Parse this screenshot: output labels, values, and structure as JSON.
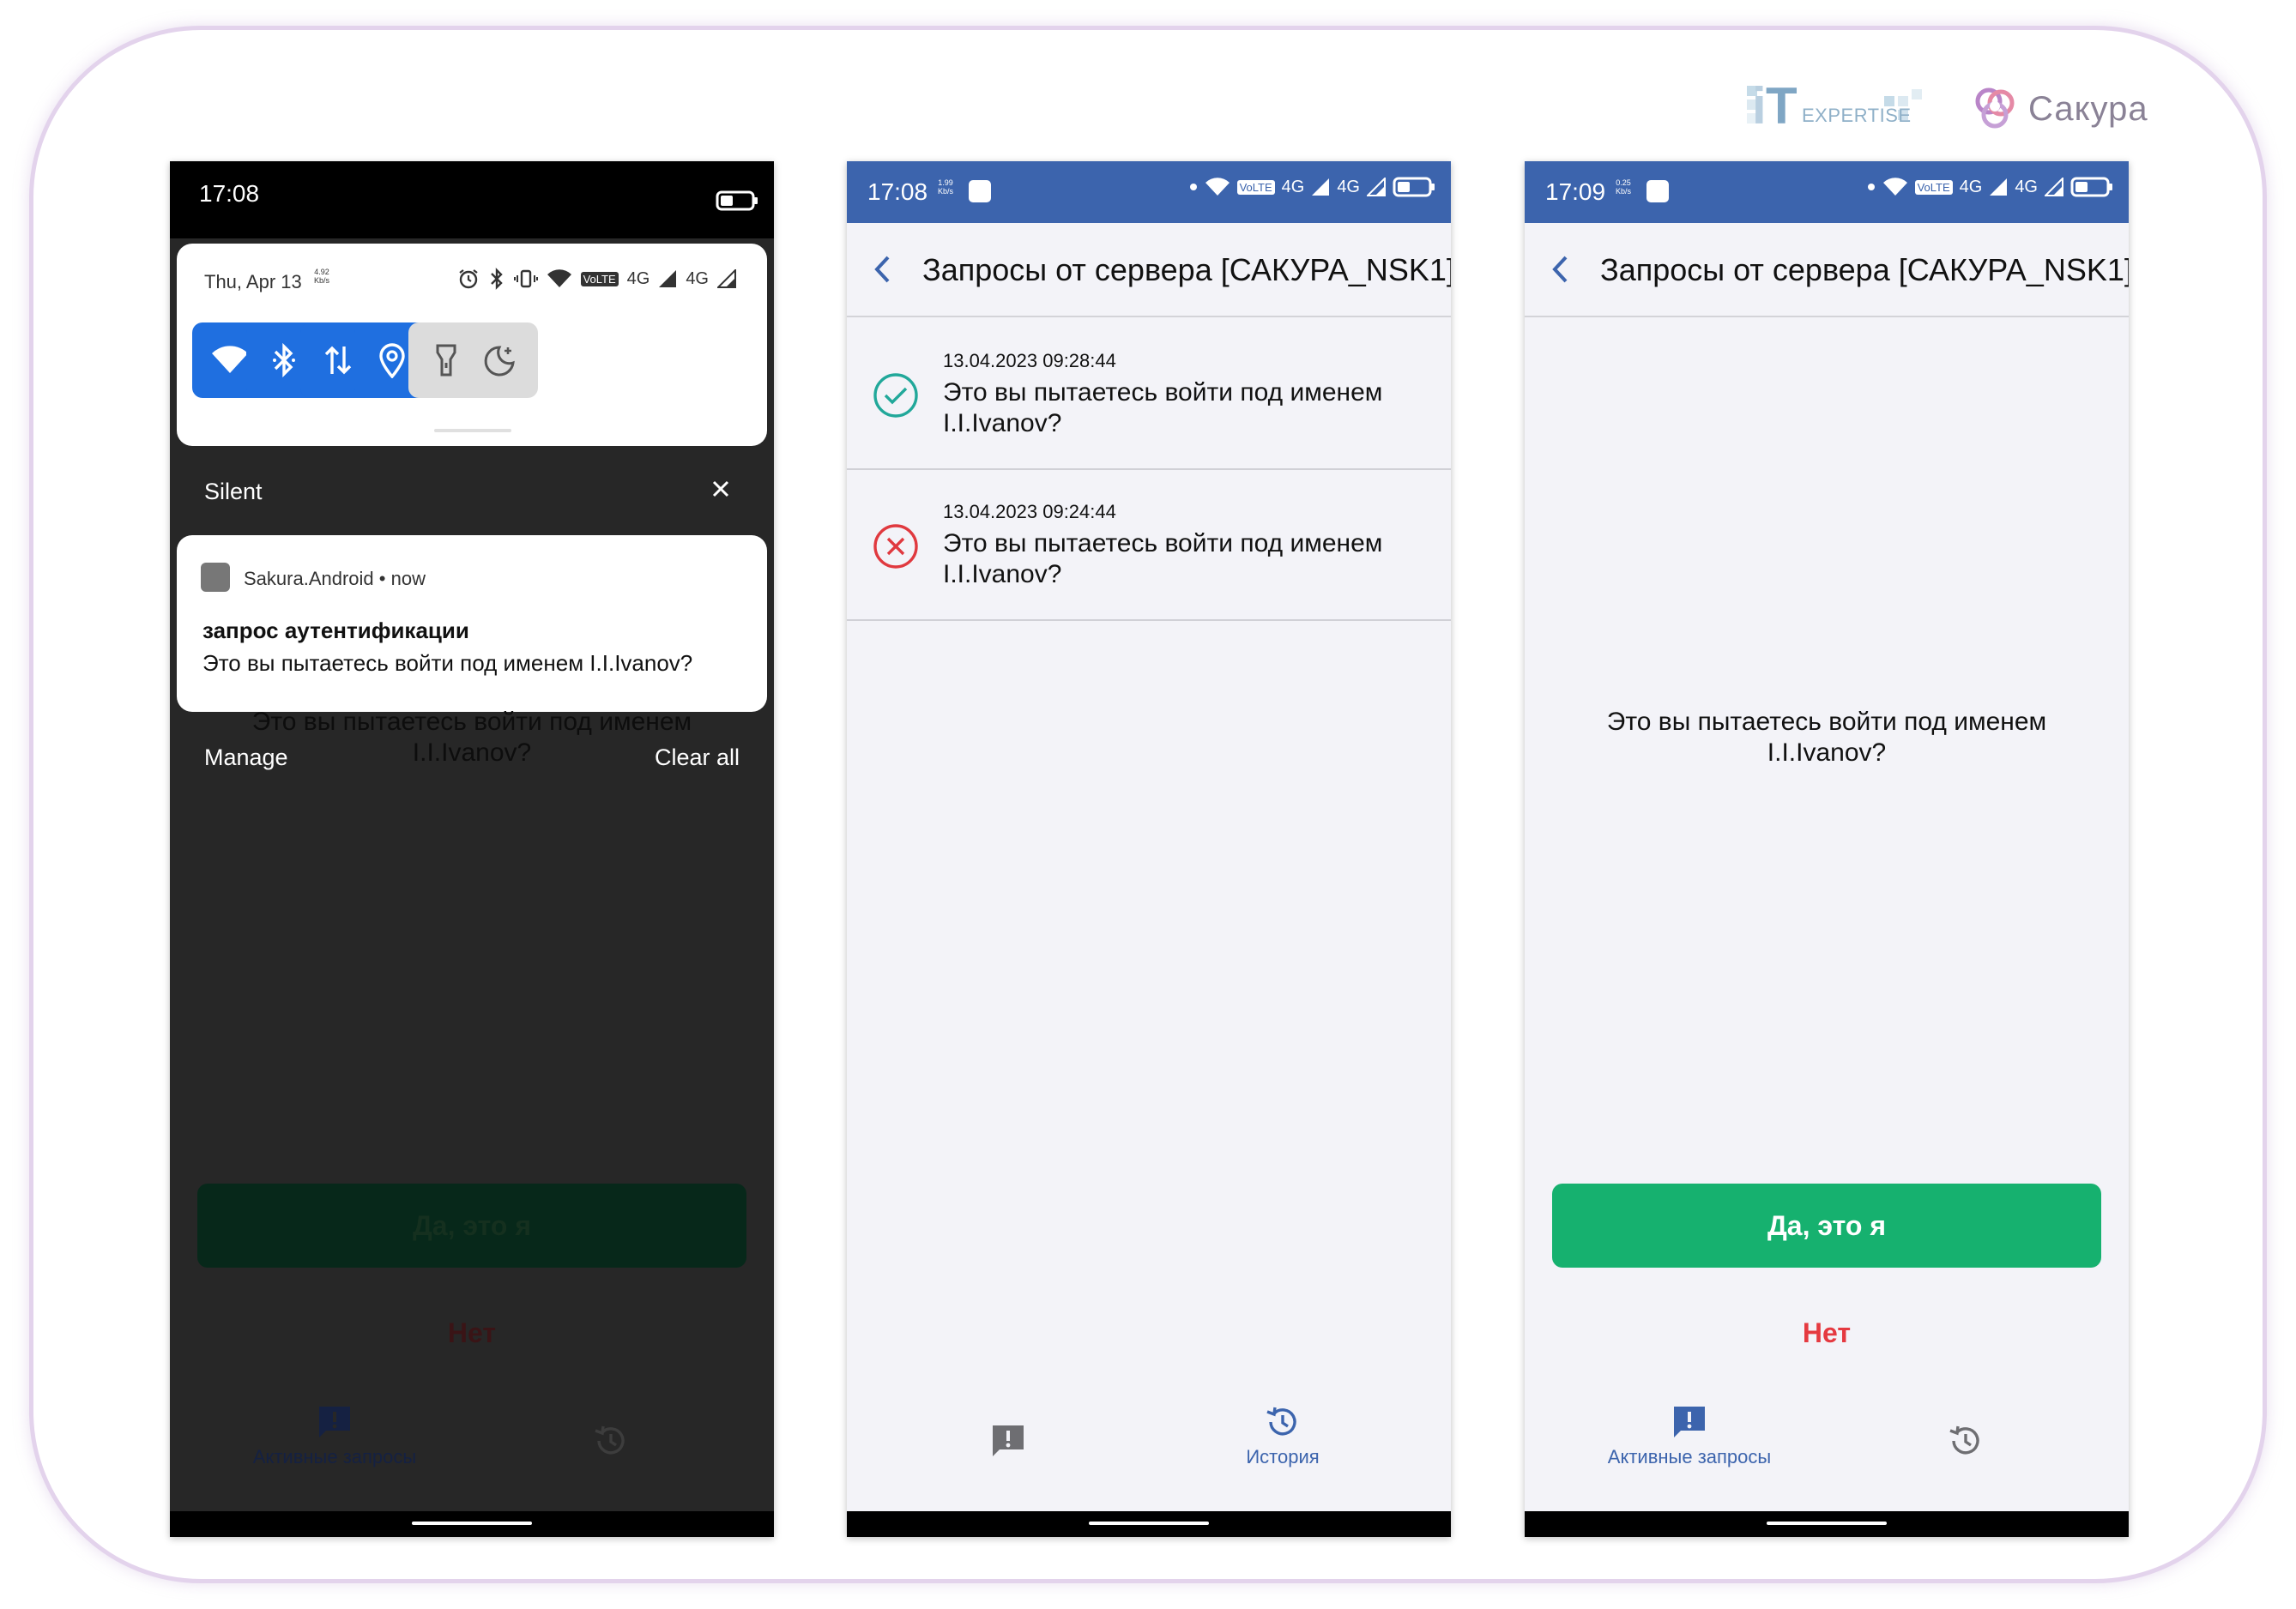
{
  "logos": {
    "it_expertise": "EXPERTISE",
    "sakura": "Сакура"
  },
  "colors": {
    "status_bar": "#3c64ad",
    "accent_green": "#16b16f",
    "accent_red": "#e53940",
    "nav_active": "#3c64ad",
    "qs_tile_on": "#1f6fe0"
  },
  "phone1": {
    "time": "17:08",
    "qs_date": "Thu, Apr 13",
    "qs_kbs_value": "4.92",
    "qs_kbs_unit": "Kb/s",
    "qs_volte": "VoLTE",
    "qs_net1": "4G",
    "qs_net2": "4G",
    "qs_tiles": [
      "wifi-icon",
      "bluetooth-icon",
      "mobile-data-icon",
      "location-icon",
      "flashlight-icon",
      "night-mode-icon"
    ],
    "silent_label": "Silent",
    "notification": {
      "app": "Sakura.Android",
      "when": "now",
      "title": "запрос аутентификации",
      "body": "Это вы пытаетесь войти под именем I.I.Ivanov?"
    },
    "background_line1": "Это вы пытаетесь войти под именем",
    "background_line2": "I.I.Ivanov?",
    "manage_label": "Manage",
    "clear_all_label": "Clear all",
    "yes_label": "Да, это я",
    "no_label": "Нет",
    "nav_active_label": "Активные запросы"
  },
  "phone2": {
    "time": "17:08",
    "kbs_value": "1.99",
    "kbs_unit": "Kb/s",
    "volte": "VoLTE",
    "net1": "4G",
    "net2": "4G",
    "title": "Запросы от сервера [САКУРА_NSK1]",
    "requests": [
      {
        "timestamp": "13.04.2023 09:28:44",
        "message": "Это вы пытаетесь войти под именем I.I.Ivanov?",
        "status": "approved"
      },
      {
        "timestamp": "13.04.2023 09:24:44",
        "message": "Это вы пытаетесь войти под именем I.I.Ivanov?",
        "status": "rejected"
      }
    ],
    "nav_history_label": "История"
  },
  "phone3": {
    "time": "17:09",
    "kbs_value": "0.25",
    "kbs_unit": "Kb/s",
    "volte": "VoLTE",
    "net1": "4G",
    "net2": "4G",
    "title": "Запросы от сервера [САКУРА_NSK1]",
    "question_line1": "Это вы пытаетесь войти под именем",
    "question_line2": "I.I.Ivanov?",
    "yes_label": "Да, это я",
    "no_label": "Нет",
    "nav_active_label": "Активные запросы"
  }
}
